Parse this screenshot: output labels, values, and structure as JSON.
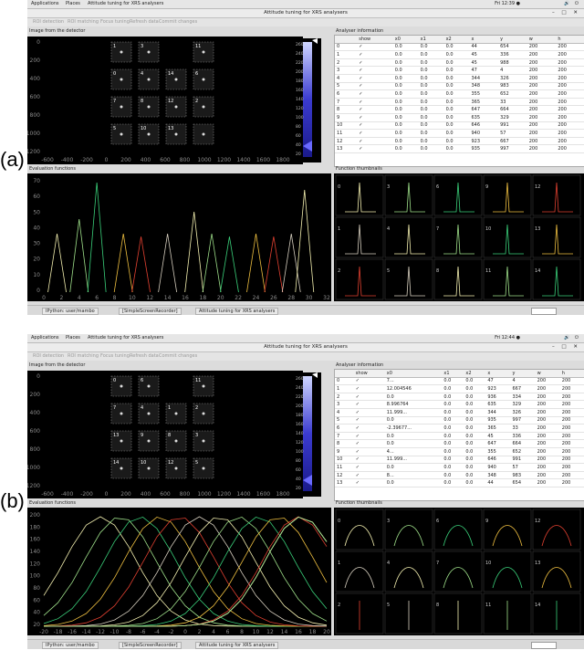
{
  "panels": [
    {
      "label": "(a)",
      "topbar": {
        "applications": "Applications",
        "places": "Places",
        "app_title": "Attitude tuning for XRS analysers",
        "clock": "Fri 12:39 ●"
      },
      "window_title": "Attitude tuning for XRS analysers",
      "toolbar": [
        "ROI detection",
        "ROI matching",
        "Focus tuning",
        "Refresh data",
        "Commit changes"
      ],
      "detector_title": "Image from the detector",
      "detector_yticks": [
        "0",
        "200",
        "400",
        "600",
        "800",
        "1000",
        "1200"
      ],
      "detector_xticks": [
        "-600",
        "-400",
        "-200",
        "0",
        "200",
        "400",
        "600",
        "800",
        "1000",
        "1200",
        "1400",
        "1600",
        "1800"
      ],
      "colorbar_ticks": [
        "260",
        "240",
        "220",
        "200",
        "180",
        "160",
        "140",
        "120",
        "100",
        "80",
        "60",
        "40",
        "20"
      ],
      "roi_labels": [
        "1",
        "3",
        "11",
        "0",
        "4",
        "14",
        "6",
        "7",
        "8",
        "12",
        "2",
        "5",
        "10",
        "13"
      ],
      "info_title": "Analyser information",
      "info_columns": [
        "",
        "show",
        "x0",
        "x1",
        "x2",
        "x",
        "y",
        "w",
        "h"
      ],
      "info_rows": [
        [
          "0",
          "✓",
          "0.0",
          "0.0",
          "0.0",
          "44",
          "654",
          "200",
          "200"
        ],
        [
          "1",
          "✓",
          "0.0",
          "0.0",
          "0.0",
          "45",
          "336",
          "200",
          "200"
        ],
        [
          "2",
          "✓",
          "0.0",
          "0.0",
          "0.0",
          "45",
          "988",
          "200",
          "200"
        ],
        [
          "3",
          "✓",
          "0.0",
          "0.0",
          "0.0",
          "47",
          "4",
          "200",
          "200"
        ],
        [
          "4",
          "✓",
          "0.0",
          "0.0",
          "0.0",
          "344",
          "326",
          "200",
          "200"
        ],
        [
          "5",
          "✓",
          "0.0",
          "0.0",
          "0.0",
          "348",
          "983",
          "200",
          "200"
        ],
        [
          "6",
          "✓",
          "0.0",
          "0.0",
          "0.0",
          "355",
          "652",
          "200",
          "200"
        ],
        [
          "7",
          "✓",
          "0.0",
          "0.0",
          "0.0",
          "365",
          "33",
          "200",
          "200"
        ],
        [
          "8",
          "✓",
          "0.0",
          "0.0",
          "0.0",
          "647",
          "664",
          "200",
          "200"
        ],
        [
          "9",
          "✓",
          "0.0",
          "0.0",
          "0.0",
          "635",
          "329",
          "200",
          "200"
        ],
        [
          "10",
          "✓",
          "0.0",
          "0.0",
          "0.0",
          "646",
          "991",
          "200",
          "200"
        ],
        [
          "11",
          "✓",
          "0.0",
          "0.0",
          "0.0",
          "940",
          "57",
          "200",
          "200"
        ],
        [
          "12",
          "✓",
          "0.0",
          "0.0",
          "0.0",
          "923",
          "667",
          "200",
          "200"
        ],
        [
          "13",
          "✓",
          "0.0",
          "0.0",
          "0.0",
          "935",
          "997",
          "200",
          "200"
        ]
      ],
      "eval_title": "Evaluation functions",
      "eval_yticks": [
        "70",
        "60",
        "50",
        "40",
        "30",
        "20",
        "10",
        "0"
      ],
      "eval_xticks": [
        "0",
        "2",
        "4",
        "6",
        "8",
        "10",
        "12",
        "14",
        "16",
        "18",
        "20",
        "22",
        "24",
        "26",
        "28",
        "30",
        "32"
      ],
      "thumbs_title": "Function thumbnails",
      "thumb_labels": [
        "0",
        "3",
        "6",
        "9",
        "12",
        "1",
        "4",
        "7",
        "10",
        "13",
        "2",
        "5",
        "8",
        "11",
        "14"
      ],
      "statusbar": {
        "task1": "IPython: user/mambo",
        "task2": "[SimpleScreenRecorder]",
        "task3": "Attitude tuning for XRS analysers"
      }
    },
    {
      "label": "(b)",
      "topbar": {
        "applications": "Applications",
        "places": "Places",
        "app_title": "Attitude tuning for XRS analysers",
        "clock": "Fri 12:44 ●"
      },
      "window_title": "Attitude tuning for XRS analysers",
      "toolbar": [
        "ROI detection",
        "ROI matching",
        "Focus tuning",
        "Refresh data",
        "Commit changes"
      ],
      "detector_title": "Image from the detector",
      "detector_yticks": [
        "0",
        "200",
        "400",
        "600",
        "800",
        "1000",
        "1200"
      ],
      "detector_xticks": [
        "-600",
        "-400",
        "-200",
        "0",
        "200",
        "400",
        "600",
        "800",
        "1000",
        "1200",
        "1400",
        "1600",
        "1800"
      ],
      "colorbar_ticks": [
        "260",
        "240",
        "220",
        "200",
        "180",
        "160",
        "140",
        "120",
        "100",
        "80",
        "60",
        "40",
        "20"
      ],
      "roi_labels": [
        "0",
        "6",
        "11",
        "7",
        "4",
        "1",
        "2",
        "13",
        "9",
        "8",
        "3",
        "14",
        "10",
        "12",
        "5"
      ],
      "info_title": "Analyser information",
      "info_columns": [
        "",
        "show",
        "x0",
        "x1",
        "x2",
        "x",
        "y",
        "w",
        "h"
      ],
      "info_rows": [
        [
          "0",
          "✓",
          "7...",
          "0.0",
          "0.0",
          "47",
          "4",
          "200",
          "200"
        ],
        [
          "1",
          "✓",
          "12.004546",
          "0.0",
          "0.0",
          "923",
          "667",
          "200",
          "200"
        ],
        [
          "2",
          "✓",
          "0.0",
          "0.0",
          "0.0",
          "936",
          "334",
          "200",
          "200"
        ],
        [
          "3",
          "✓",
          "8.996764",
          "0.0",
          "0.0",
          "635",
          "329",
          "200",
          "200"
        ],
        [
          "4",
          "✓",
          "11.999...",
          "0.0",
          "0.0",
          "344",
          "326",
          "200",
          "200"
        ],
        [
          "5",
          "✓",
          "0.0",
          "0.0",
          "0.0",
          "935",
          "997",
          "200",
          "200"
        ],
        [
          "6",
          "✓",
          "-2.39677...",
          "0.0",
          "0.0",
          "365",
          "33",
          "200",
          "200"
        ],
        [
          "7",
          "✓",
          "0.0",
          "0.0",
          "0.0",
          "45",
          "336",
          "200",
          "200"
        ],
        [
          "8",
          "✓",
          "0.0",
          "0.0",
          "0.0",
          "647",
          "664",
          "200",
          "200"
        ],
        [
          "9",
          "✓",
          "4...",
          "0.0",
          "0.0",
          "355",
          "652",
          "200",
          "200"
        ],
        [
          "10",
          "✓",
          "11.999...",
          "0.0",
          "0.0",
          "646",
          "991",
          "200",
          "200"
        ],
        [
          "11",
          "✓",
          "0.0",
          "0.0",
          "0.0",
          "940",
          "57",
          "200",
          "200"
        ],
        [
          "12",
          "✓",
          "8...",
          "0.0",
          "0.0",
          "348",
          "983",
          "200",
          "200"
        ],
        [
          "13",
          "✓",
          "0.0",
          "0.0",
          "0.0",
          "44",
          "654",
          "200",
          "200"
        ]
      ],
      "eval_title": "Evaluation functions",
      "eval_yticks": [
        "200",
        "180",
        "160",
        "140",
        "120",
        "100",
        "80",
        "60",
        "40",
        "20"
      ],
      "eval_xticks": [
        "-20",
        "-18",
        "-16",
        "-14",
        "-12",
        "-10",
        "-8",
        "-6",
        "-4",
        "-2",
        "0",
        "2",
        "4",
        "6",
        "8",
        "10",
        "12",
        "14",
        "16",
        "18",
        "20"
      ],
      "thumbs_title": "Function thumbnails",
      "thumb_labels": [
        "0",
        "3",
        "6",
        "9",
        "12",
        "1",
        "4",
        "7",
        "10",
        "13",
        "2",
        "5",
        "8",
        "11",
        "14"
      ],
      "statusbar": {
        "task1": "IPython: user/mambo",
        "task2": "[SimpleScreenRecorder]",
        "task3": "Attitude tuning for XRS analysers"
      }
    }
  ],
  "colors": {
    "peak_palette": [
      "#f4f0b0",
      "#9fe08a",
      "#3ad07a",
      "#f0c040",
      "#e04030",
      "#d8d0c0"
    ]
  }
}
